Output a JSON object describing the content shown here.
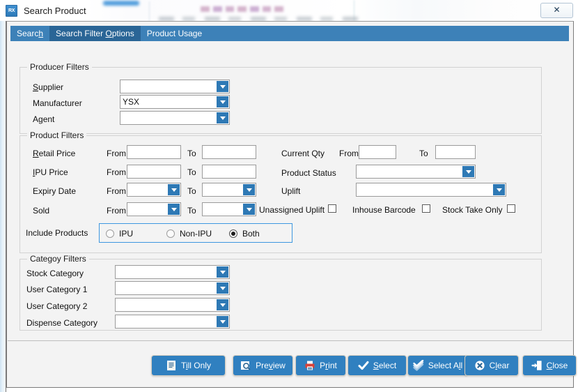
{
  "window": {
    "title": "Search Product",
    "app_icon": "rx-icon",
    "icon_text": "RX",
    "close_label": "✕",
    "close_icon": "close-icon"
  },
  "tabs": [
    {
      "id": "search",
      "label_pre": "Searc",
      "accel": "h",
      "label_post": "",
      "active": false
    },
    {
      "id": "search-filter-options",
      "label_pre": "Search Filter ",
      "accel": "O",
      "label_post": "ptions",
      "active": true
    },
    {
      "id": "product-usage",
      "label_pre": "Product Usage",
      "accel": "",
      "label_post": "",
      "active": false
    }
  ],
  "producer_filters": {
    "title": "Producer Filters",
    "supplier": {
      "label_pre": "",
      "accel": "S",
      "label_post": "upplier",
      "value": ""
    },
    "manufacturer": {
      "label_pre": "Manufacturer",
      "accel": "",
      "label_post": "",
      "value": "YSX"
    },
    "agent": {
      "label_pre": "A",
      "accel": "g",
      "label_post": "ent",
      "value": ""
    }
  },
  "product_filters": {
    "title": "Product Filters",
    "from_label": "From",
    "to_label": "To",
    "retail_price": {
      "label_pre": "",
      "accel": "R",
      "label_post": "etail Price",
      "from": "",
      "to": ""
    },
    "ipu_price": {
      "label_pre": "",
      "accel": "I",
      "label_post": "PU Price",
      "from": "",
      "to": ""
    },
    "expiry_date": {
      "label": "Expiry Date",
      "from": "",
      "to": ""
    },
    "sold": {
      "label": "Sold",
      "from": "",
      "to": ""
    },
    "current_qty": {
      "label": "Current Qty",
      "from": "",
      "to": ""
    },
    "product_status": {
      "label": "Product Status",
      "value": ""
    },
    "uplift": {
      "label": "Uplift",
      "value": ""
    },
    "checkboxes": [
      {
        "id": "unassigned-uplift",
        "label": "Unassigned Uplift",
        "checked": false
      },
      {
        "id": "inhouse-barcode",
        "label": "Inhouse Barcode",
        "checked": false
      },
      {
        "id": "stock-take-only",
        "label": "Stock Take Only",
        "checked": false
      }
    ],
    "include_products": {
      "label": "Include Products",
      "options": [
        {
          "id": "ipu",
          "label": "IPU",
          "selected": false
        },
        {
          "id": "non-ipu",
          "label": "Non-IPU",
          "selected": false
        },
        {
          "id": "both",
          "label": "Both",
          "selected": true
        }
      ]
    }
  },
  "category_filters": {
    "title": "Categoy Filters",
    "stock_category": {
      "label": "Stock Category",
      "value": ""
    },
    "user_category_1": {
      "label": "User Category 1",
      "value": ""
    },
    "user_category_2": {
      "label": "User Category 2",
      "value": ""
    },
    "dispense_category": {
      "label": "Dispense Category",
      "value": ""
    }
  },
  "buttons": [
    {
      "id": "till-only",
      "icon": "document-icon",
      "pre": "T",
      "accel": "i",
      "post": "ll Only"
    },
    {
      "id": "preview",
      "icon": "magnifier-icon",
      "pre": "Pre",
      "accel": "v",
      "post": "iew"
    },
    {
      "id": "print",
      "icon": "printer-icon",
      "pre": "P",
      "accel": "r",
      "post": "int"
    },
    {
      "id": "select",
      "icon": "check-icon",
      "pre": "",
      "accel": "S",
      "post": "elect"
    },
    {
      "id": "select-all",
      "icon": "stack-check-icon",
      "pre": "Select A",
      "accel": "l",
      "post": "l"
    },
    {
      "id": "clear",
      "icon": "clear-x-icon",
      "pre": "C",
      "accel": "l",
      "post": "ear"
    },
    {
      "id": "close",
      "icon": "exit-door-icon",
      "pre": "",
      "accel": "C",
      "post": "lose"
    }
  ],
  "colors": {
    "tab_bar": "#3d81b8",
    "tab_active": "#2a6596",
    "button": "#3080c0",
    "combo_arrow": "#2e79b5",
    "focus_border": "#3d97e0",
    "client_bg": "#f3f3f3"
  }
}
